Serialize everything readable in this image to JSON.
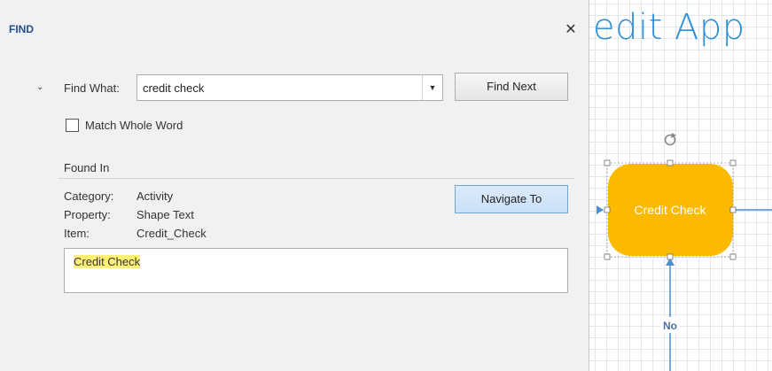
{
  "find_panel": {
    "title": "FIND",
    "close_glyph": "✕",
    "expand_glyph": "⌄",
    "find_what_label": "Find What:",
    "find_what_value": "credit check",
    "dropdown_glyph": "▼",
    "find_next_label": "Find Next",
    "match_whole_word_label": "Match Whole Word",
    "match_whole_word_checked": false,
    "found_in_label": "Found In",
    "details": [
      {
        "key": "Category:",
        "value": "Activity"
      },
      {
        "key": "Property:",
        "value": "Shape Text"
      },
      {
        "key": "Item:",
        "value": "Credit_Check"
      }
    ],
    "navigate_label": "Navigate To",
    "result_text": "Credit Check"
  },
  "canvas": {
    "title_fragment": "edit App",
    "shape_label": "Credit Check",
    "connector_label": "No",
    "rotate_icon": "rotate-handle-icon",
    "colors": {
      "shape_fill": "#fbb900",
      "title": "#2e8fd4",
      "connector": "#4a8fd1"
    }
  }
}
